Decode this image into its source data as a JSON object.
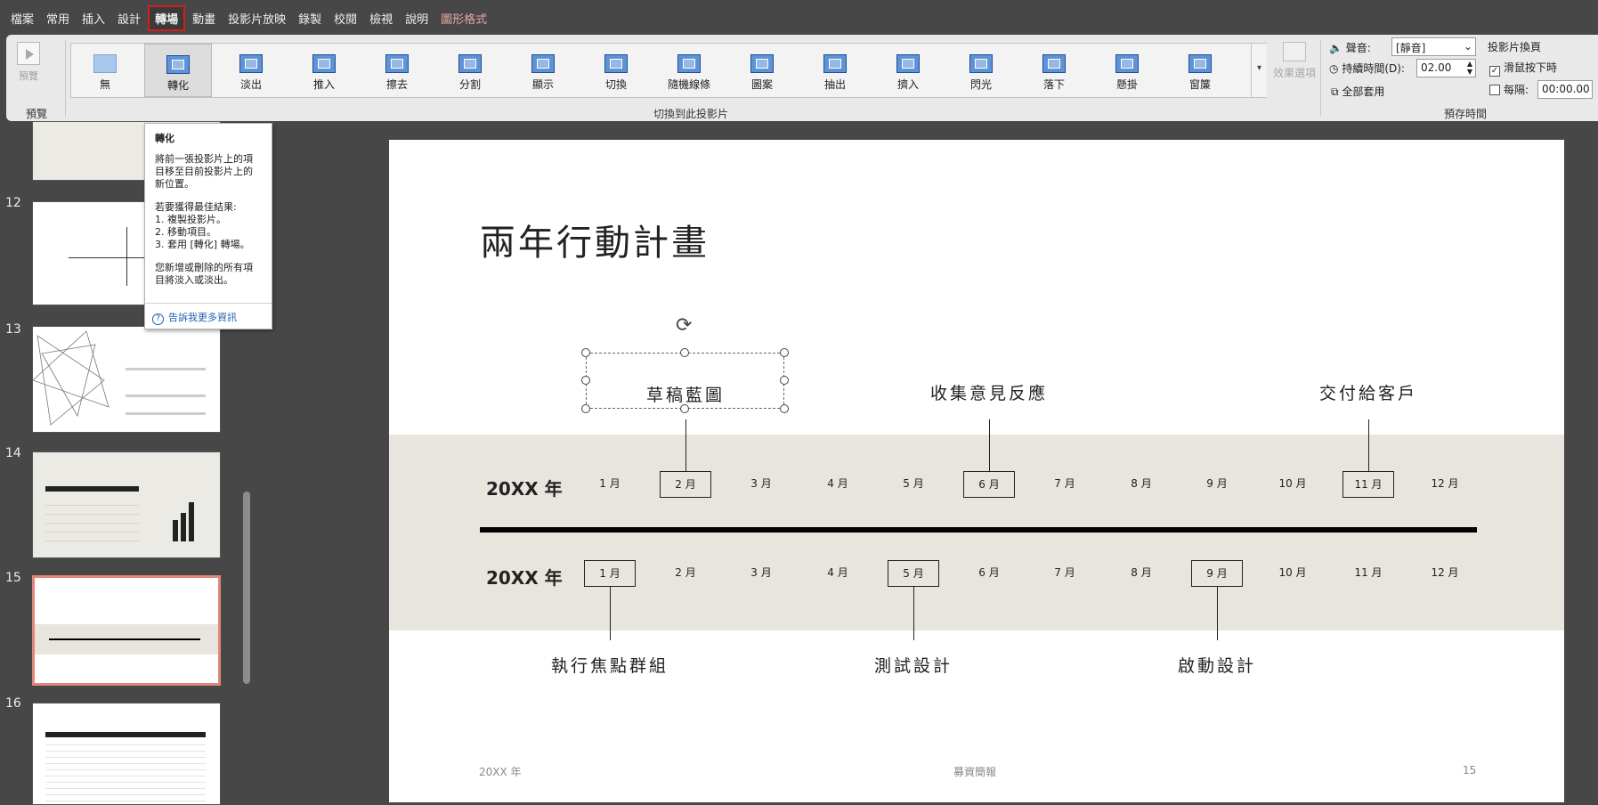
{
  "menu": {
    "items": [
      "檔案",
      "常用",
      "插入",
      "設計",
      "轉場",
      "動畫",
      "投影片放映",
      "錄製",
      "校閱",
      "檢視",
      "說明",
      "圖形格式"
    ],
    "active": "轉場"
  },
  "ribbon": {
    "preview_label": "預覽",
    "preview_group": "預覽",
    "transitions": [
      "無",
      "轉化",
      "淡出",
      "推入",
      "擦去",
      "分割",
      "顯示",
      "切換",
      "隨機線條",
      "圖案",
      "抽出",
      "擠入",
      "閃光",
      "落下",
      "懸掛",
      "窗簾"
    ],
    "selected_transition": "轉化",
    "gallery_group": "切換到此投影片",
    "effect_options": "效果選項",
    "sound_label": "聲音:",
    "sound_value": "[靜音]",
    "duration_label": "持續時間(D):",
    "duration_value": "02.00",
    "apply_all": "全部套用",
    "advance_title": "投影片換頁",
    "on_click": "滑鼠按下時",
    "after_label": "每隔:",
    "after_value": "00:00.00",
    "timing_group": "預存時間"
  },
  "tooltip": {
    "title": "轉化",
    "body": "將前一張投影片上的項目移至目前投影片上的新位置。",
    "tips": "若要獲得最佳結果:\n1. 複製投影片。\n2. 移動項目。\n3. 套用 [轉化] 轉場。",
    "note": "您新增或刪除的所有項目將淡入或淡出。",
    "more": "告訴我更多資訊"
  },
  "thumbnails": {
    "numbers": [
      "12",
      "13",
      "14",
      "15",
      "16"
    ],
    "selected": "15"
  },
  "slide": {
    "title": "兩年行動計畫",
    "year1": "20XX 年",
    "year2": "20XX 年",
    "months": [
      "1 月",
      "2 月",
      "3 月",
      "4 月",
      "5 月",
      "6 月",
      "7 月",
      "8 月",
      "9 月",
      "10 月",
      "11 月",
      "12 月"
    ],
    "top_milestones": [
      "草稿藍圖",
      "收集意見反應",
      "交付給客戶"
    ],
    "bottom_milestones": [
      "執行焦點群組",
      "測試設計",
      "啟動設計"
    ],
    "footer_left": "20XX 年",
    "footer_center": "募資簡報",
    "footer_right": "15"
  }
}
